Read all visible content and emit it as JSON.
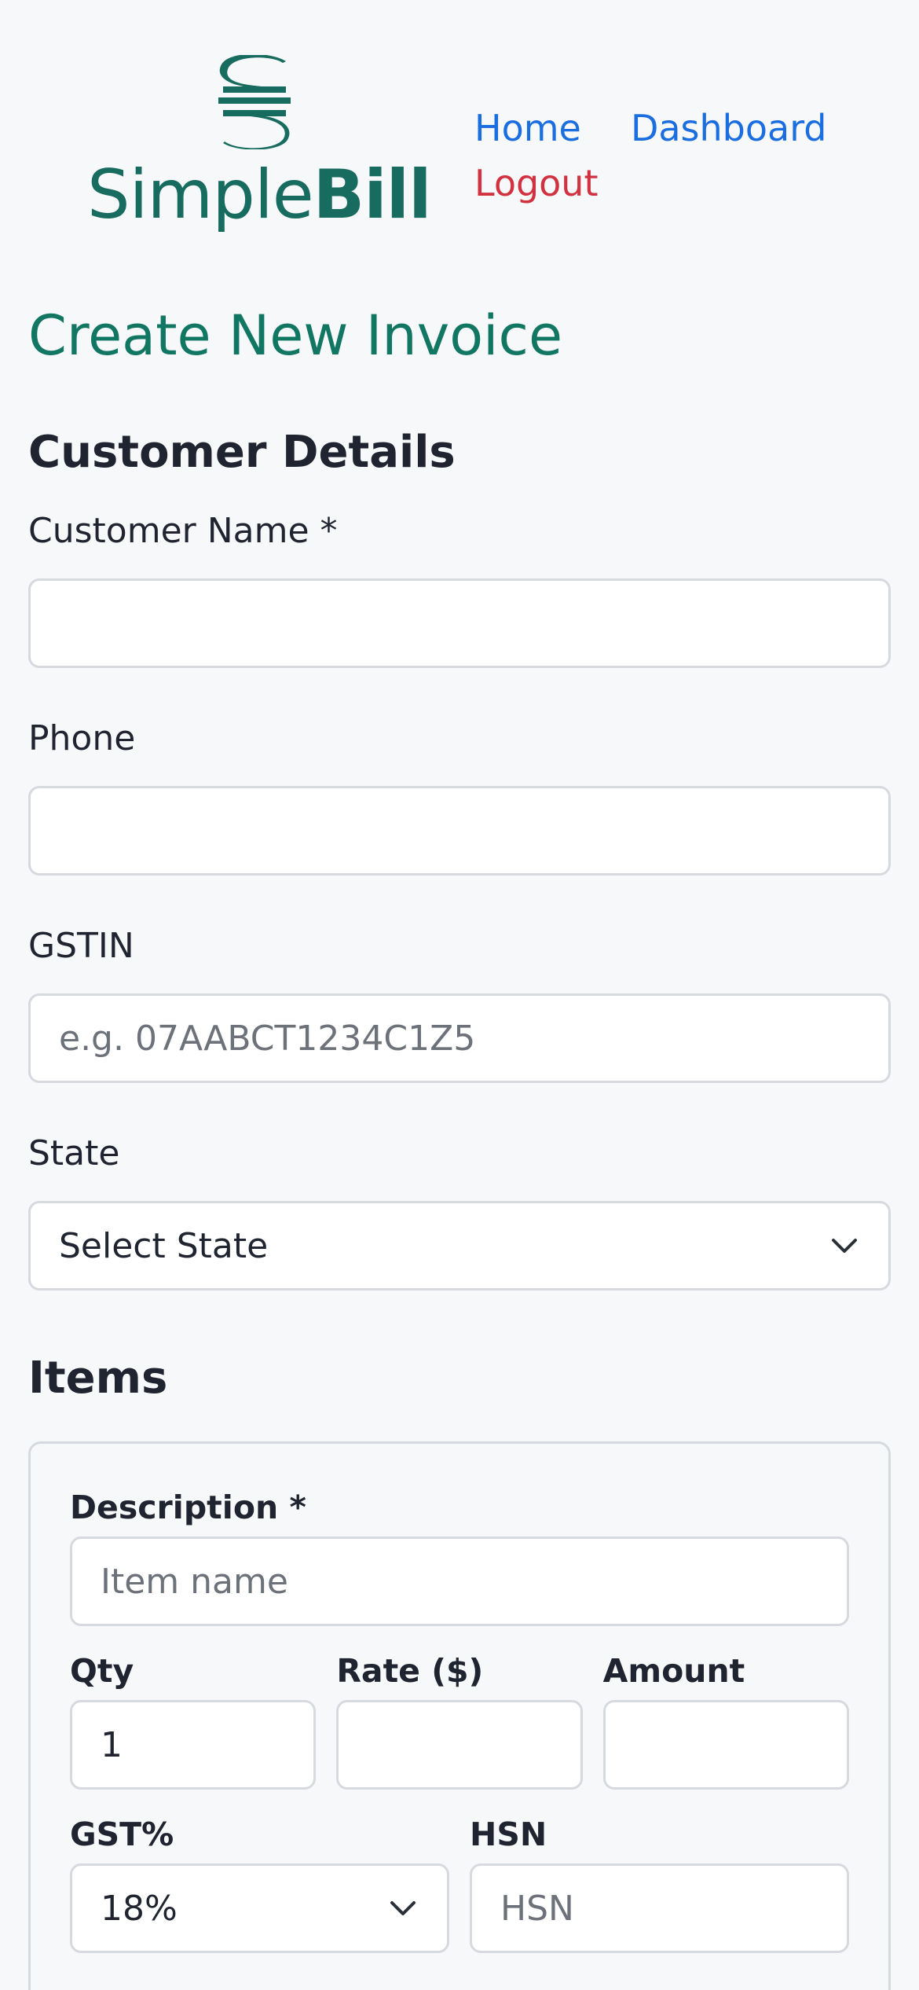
{
  "brand": {
    "name_light": "Simple",
    "name_bold": "Bill",
    "color": "#176c5f"
  },
  "nav": {
    "home": "Home",
    "dashboard": "Dashboard",
    "logout": "Logout"
  },
  "page": {
    "title": "Create New Invoice"
  },
  "customer": {
    "section_title": "Customer Details",
    "name_label": "Customer Name *",
    "name_value": "",
    "phone_label": "Phone",
    "phone_value": "",
    "gstin_label": "GSTIN",
    "gstin_placeholder": "e.g. 07AABCT1234C1Z5",
    "state_label": "State",
    "state_selected": "Select State"
  },
  "items": {
    "section_title": "Items",
    "description_label": "Description *",
    "description_placeholder": "Item name",
    "qty_label": "Qty",
    "qty_value": "1",
    "rate_label": "Rate ($)",
    "rate_value": "",
    "amount_label": "Amount",
    "amount_value": "",
    "gst_label": "GST%",
    "gst_selected": "18%",
    "hsn_label": "HSN",
    "hsn_placeholder": "HSN"
  },
  "icons": {
    "logo": "simplebill-logo-icon",
    "dropdown": "chevron-down-icon"
  },
  "colors": {
    "title": "#117662",
    "link": "#1a6ee0",
    "logout": "#d2323f",
    "background": "#f7f8fa"
  }
}
